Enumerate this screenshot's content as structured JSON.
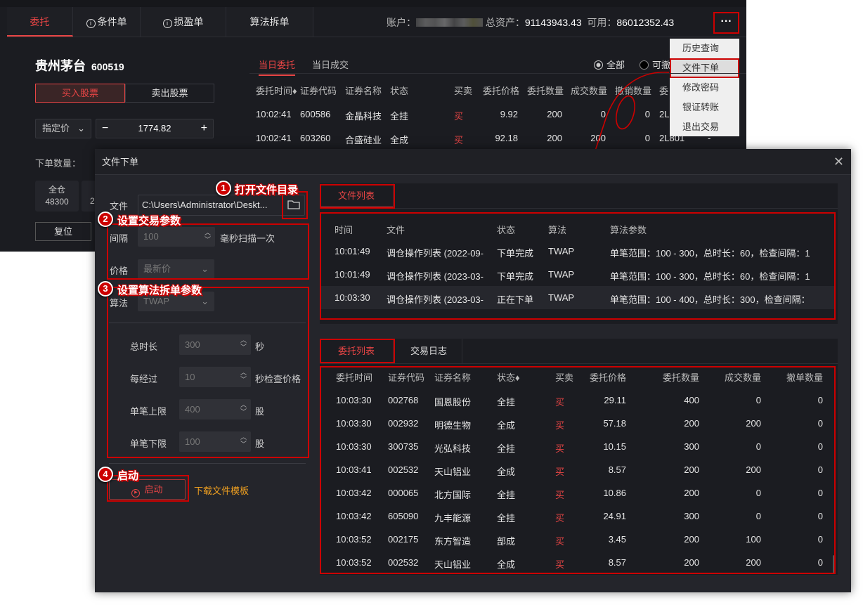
{
  "app": {
    "tabs": [
      {
        "label": "委托",
        "active": true
      },
      {
        "label": "条件单",
        "icon": "info-icon"
      },
      {
        "label": "损盈单",
        "icon": "info-icon"
      },
      {
        "label": "算法拆单"
      }
    ],
    "account_label": "账户：",
    "total_assets_label": "总资产：",
    "total_assets": "91143943.43",
    "available_label": "可用：",
    "available": "86012352.43",
    "more_label": "···",
    "menu": [
      "历史查询",
      "文件下单",
      "修改密码",
      "银证转账",
      "退出交易"
    ],
    "stock_name": "贵州茅台",
    "stock_code": "600519",
    "buy_label": "买入股票",
    "sell_label": "卖出股票",
    "price_type": "指定价",
    "price": "1774.82",
    "minus": "−",
    "plus": "+",
    "qty_label": "下单数量：",
    "quick": [
      {
        "label": "全仓",
        "value": "48300"
      },
      {
        "label": "",
        "value": "2"
      }
    ],
    "reset_label": "复位",
    "order_tabs": [
      "当日委托",
      "当日成交"
    ],
    "radios": [
      {
        "label": "全部",
        "checked": true
      },
      {
        "label": "可撤",
        "checked": false
      }
    ],
    "order_headers": [
      "委托时间",
      "证券代码",
      "证券名称",
      "状态",
      "买卖",
      "委托价格",
      "委托数量",
      "成交数量",
      "撤销数量",
      "委"
    ],
    "orders": [
      [
        "10:02:41",
        "600586",
        "金晶科技",
        "全挂",
        "买",
        "9.92",
        "200",
        "0",
        "0",
        "2L"
      ],
      [
        "10:02:41",
        "603260",
        "合盛硅业",
        "全成",
        "买",
        "92.18",
        "200",
        "200",
        "0",
        "2L801",
        "-"
      ]
    ]
  },
  "dialog": {
    "title": "文件下单",
    "close": "✕",
    "file_label": "文件",
    "file_path": "C:\\Users\\Administrator\\Deskt...",
    "interval_label": "间隔",
    "interval": "100",
    "interval_unit": "毫秒扫描一次",
    "price_label": "价格",
    "price_value": "最新价",
    "algo_label": "算法",
    "algo_value": "TWAP",
    "params": [
      {
        "label": "总时长",
        "value": "300",
        "unit": "秒"
      },
      {
        "label": "每经过",
        "value": "10",
        "unit": "秒检查价格"
      },
      {
        "label": "单笔上限",
        "value": "400",
        "unit": "股"
      },
      {
        "label": "单笔下限",
        "value": "100",
        "unit": "股"
      }
    ],
    "start_label": "启动",
    "template_link": "下载文件模板",
    "file_tab": "文件列表",
    "file_headers": [
      "时间",
      "文件",
      "状态",
      "算法",
      "算法参数"
    ],
    "files": [
      [
        "10:01:49",
        "调仓操作列表 (2022-09-",
        "下单完成",
        "TWAP",
        "单笔范围：100 - 300，总时长：60，检查间隔：1"
      ],
      [
        "10:01:49",
        "调仓操作列表 (2023-03-",
        "下单完成",
        "TWAP",
        "单笔范围：100 - 300，总时长：60，检查间隔：1"
      ],
      [
        "10:03:30",
        "调仓操作列表 (2023-03-",
        "正在下单",
        "TWAP",
        "单笔范围：100 - 400，总时长：300，检查间隔："
      ]
    ],
    "bottom_tabs": [
      "委托列表",
      "交易日志"
    ],
    "order_headers": [
      "委托时间",
      "证券代码",
      "证券名称",
      "状态",
      "买卖",
      "委托价格",
      "委托数量",
      "成交数量",
      "撤单数量"
    ],
    "orders": [
      [
        "10:03:30",
        "002768",
        "国恩股份",
        "全挂",
        "买",
        "29.11",
        "400",
        "0",
        "0"
      ],
      [
        "10:03:30",
        "002932",
        "明德生物",
        "全成",
        "买",
        "57.18",
        "200",
        "200",
        "0"
      ],
      [
        "10:03:30",
        "300735",
        "光弘科技",
        "全挂",
        "买",
        "10.15",
        "300",
        "0",
        "0"
      ],
      [
        "10:03:41",
        "002532",
        "天山铝业",
        "全成",
        "买",
        "8.57",
        "200",
        "200",
        "0"
      ],
      [
        "10:03:42",
        "000065",
        "北方国际",
        "全挂",
        "买",
        "10.86",
        "200",
        "0",
        "0"
      ],
      [
        "10:03:42",
        "605090",
        "九丰能源",
        "全挂",
        "买",
        "24.91",
        "300",
        "0",
        "0"
      ],
      [
        "10:03:52",
        "002175",
        "东方智造",
        "部成",
        "买",
        "3.45",
        "200",
        "100",
        "0"
      ],
      [
        "10:03:52",
        "002532",
        "天山铝业",
        "全成",
        "买",
        "8.57",
        "200",
        "200",
        "0"
      ]
    ]
  },
  "annotations": [
    {
      "num": "1",
      "text": "打开文件目录"
    },
    {
      "num": "2",
      "text": "设置交易参数"
    },
    {
      "num": "3",
      "text": "设置算法拆单参数"
    },
    {
      "num": "4",
      "text": "启动"
    }
  ],
  "colors": {
    "accent": "#e84545",
    "annotation": "#cc0000",
    "link": "#f0a020",
    "bg": "#1b1c21"
  }
}
